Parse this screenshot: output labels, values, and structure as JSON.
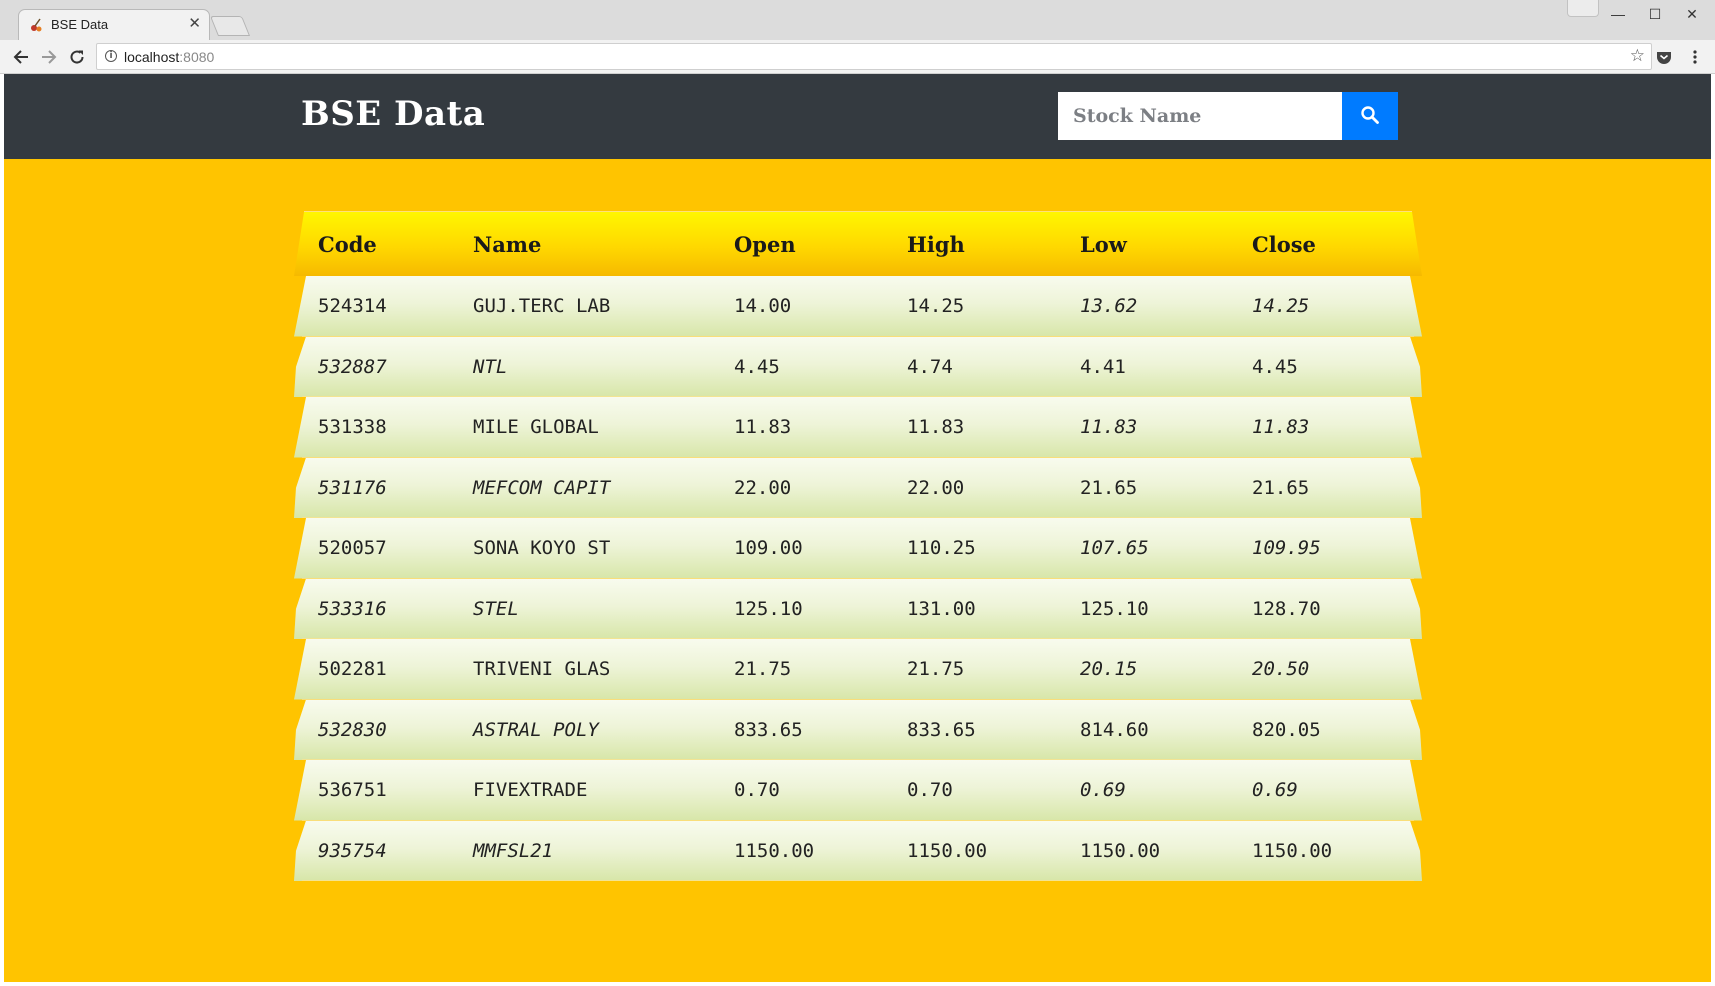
{
  "browser": {
    "tab_title": "BSE Data",
    "url_host": "localhost",
    "url_port": ":8080",
    "icons": [
      "back-icon",
      "forward-icon",
      "reload-icon",
      "info-icon",
      "star-icon",
      "pocket-icon",
      "menu-icon"
    ]
  },
  "navbar": {
    "brand": "BSE Data",
    "search_placeholder": "Stock Name",
    "search_icon": "search-icon"
  },
  "table": {
    "columns": [
      "Code",
      "Name",
      "Open",
      "High",
      "Low",
      "Close"
    ],
    "rows": [
      {
        "code": "524314",
        "name": "GUJ.TERC LAB",
        "open": "14.00",
        "high": "14.25",
        "low": "13.62",
        "close": "14.25"
      },
      {
        "code": "532887",
        "name": "NTL",
        "open": "4.45",
        "high": "4.74",
        "low": "4.41",
        "close": "4.45"
      },
      {
        "code": "531338",
        "name": "MILE GLOBAL",
        "open": "11.83",
        "high": "11.83",
        "low": "11.83",
        "close": "11.83"
      },
      {
        "code": "531176",
        "name": "MEFCOM CAPIT",
        "open": "22.00",
        "high": "22.00",
        "low": "21.65",
        "close": "21.65"
      },
      {
        "code": "520057",
        "name": "SONA KOYO ST",
        "open": "109.00",
        "high": "110.25",
        "low": "107.65",
        "close": "109.95"
      },
      {
        "code": "533316",
        "name": "STEL",
        "open": "125.10",
        "high": "131.00",
        "low": "125.10",
        "close": "128.70"
      },
      {
        "code": "502281",
        "name": "TRIVENI GLAS",
        "open": "21.75",
        "high": "21.75",
        "low": "20.15",
        "close": "20.50"
      },
      {
        "code": "532830",
        "name": "ASTRAL POLY",
        "open": "833.65",
        "high": "833.65",
        "low": "814.60",
        "close": "820.05"
      },
      {
        "code": "536751",
        "name": "FIVEXTRADE",
        "open": "0.70",
        "high": "0.70",
        "low": "0.69",
        "close": "0.69"
      },
      {
        "code": "935754",
        "name": "MMFSL21",
        "open": "1150.00",
        "high": "1150.00",
        "low": "1150.00",
        "close": "1150.00"
      }
    ]
  },
  "colors": {
    "page_bg": "#ffc400",
    "navbar_bg": "#343a40",
    "search_button": "#007bff",
    "header_gradient_top": "#fff600",
    "row_gradient_bottom": "#d7e6a8"
  }
}
